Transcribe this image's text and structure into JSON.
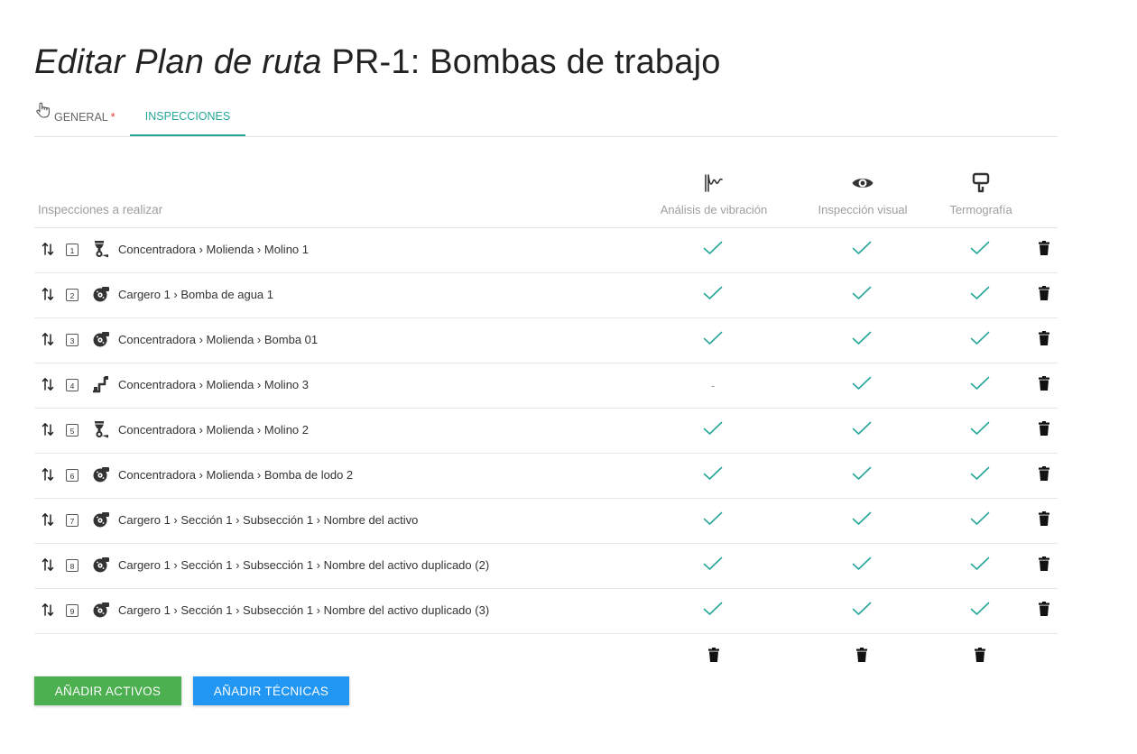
{
  "title": {
    "italic": "Editar Plan de ruta",
    "rest": "PR-1: Bombas de trabajo"
  },
  "tabs": {
    "general": "GENERAL",
    "general_required": "*",
    "inspecciones": "INSPECCIONES"
  },
  "table": {
    "header_label": "Inspecciones a realizar",
    "techniques": [
      {
        "label": "Análisis de vibración",
        "icon": "vibration-icon"
      },
      {
        "label": "Inspección visual",
        "icon": "eye-icon"
      },
      {
        "label": "Termografía",
        "icon": "thermography-icon"
      }
    ],
    "rows": [
      {
        "num": "1",
        "icon": "mill-icon",
        "path": "Concentradora › Molienda › Molino 1",
        "checks": [
          "✓",
          "✓",
          "✓"
        ]
      },
      {
        "num": "2",
        "icon": "pump-icon",
        "path": "Cargero 1 › Bomba de agua 1",
        "checks": [
          "✓",
          "✓",
          "✓"
        ]
      },
      {
        "num": "3",
        "icon": "pump-icon",
        "path": "Concentradora › Molienda › Bomba 01",
        "checks": [
          "✓",
          "✓",
          "✓"
        ]
      },
      {
        "num": "4",
        "icon": "conveyor-icon",
        "path": "Concentradora › Molienda › Molino 3",
        "checks": [
          "-",
          "✓",
          "✓"
        ]
      },
      {
        "num": "5",
        "icon": "mill-icon",
        "path": "Concentradora › Molienda › Molino 2",
        "checks": [
          "✓",
          "✓",
          "✓"
        ]
      },
      {
        "num": "6",
        "icon": "pump-icon",
        "path": "Concentradora › Molienda › Bomba de lodo 2",
        "checks": [
          "✓",
          "✓",
          "✓"
        ]
      },
      {
        "num": "7",
        "icon": "pump-icon",
        "path": "Cargero 1 › Sección 1 › Subsección 1 › Nombre del activo",
        "checks": [
          "✓",
          "✓",
          "✓"
        ]
      },
      {
        "num": "8",
        "icon": "pump-icon",
        "path": "Cargero 1 › Sección 1 › Subsección 1 › Nombre del activo duplicado (2)",
        "checks": [
          "✓",
          "✓",
          "✓"
        ]
      },
      {
        "num": "9",
        "icon": "pump-icon",
        "path": "Cargero 1 › Sección 1 › Subsección 1 › Nombre del activo duplicado (3)",
        "checks": [
          "✓",
          "✓",
          "✓"
        ]
      }
    ]
  },
  "buttons": {
    "add_assets": "AÑADIR ACTIVOS",
    "add_techniques": "AÑADIR TÉCNICAS"
  },
  "colors": {
    "check": "#26a69a",
    "accent": "#26a69a",
    "green_button": "#4caf50",
    "blue_button": "#2196f3",
    "required": "#e53935"
  }
}
